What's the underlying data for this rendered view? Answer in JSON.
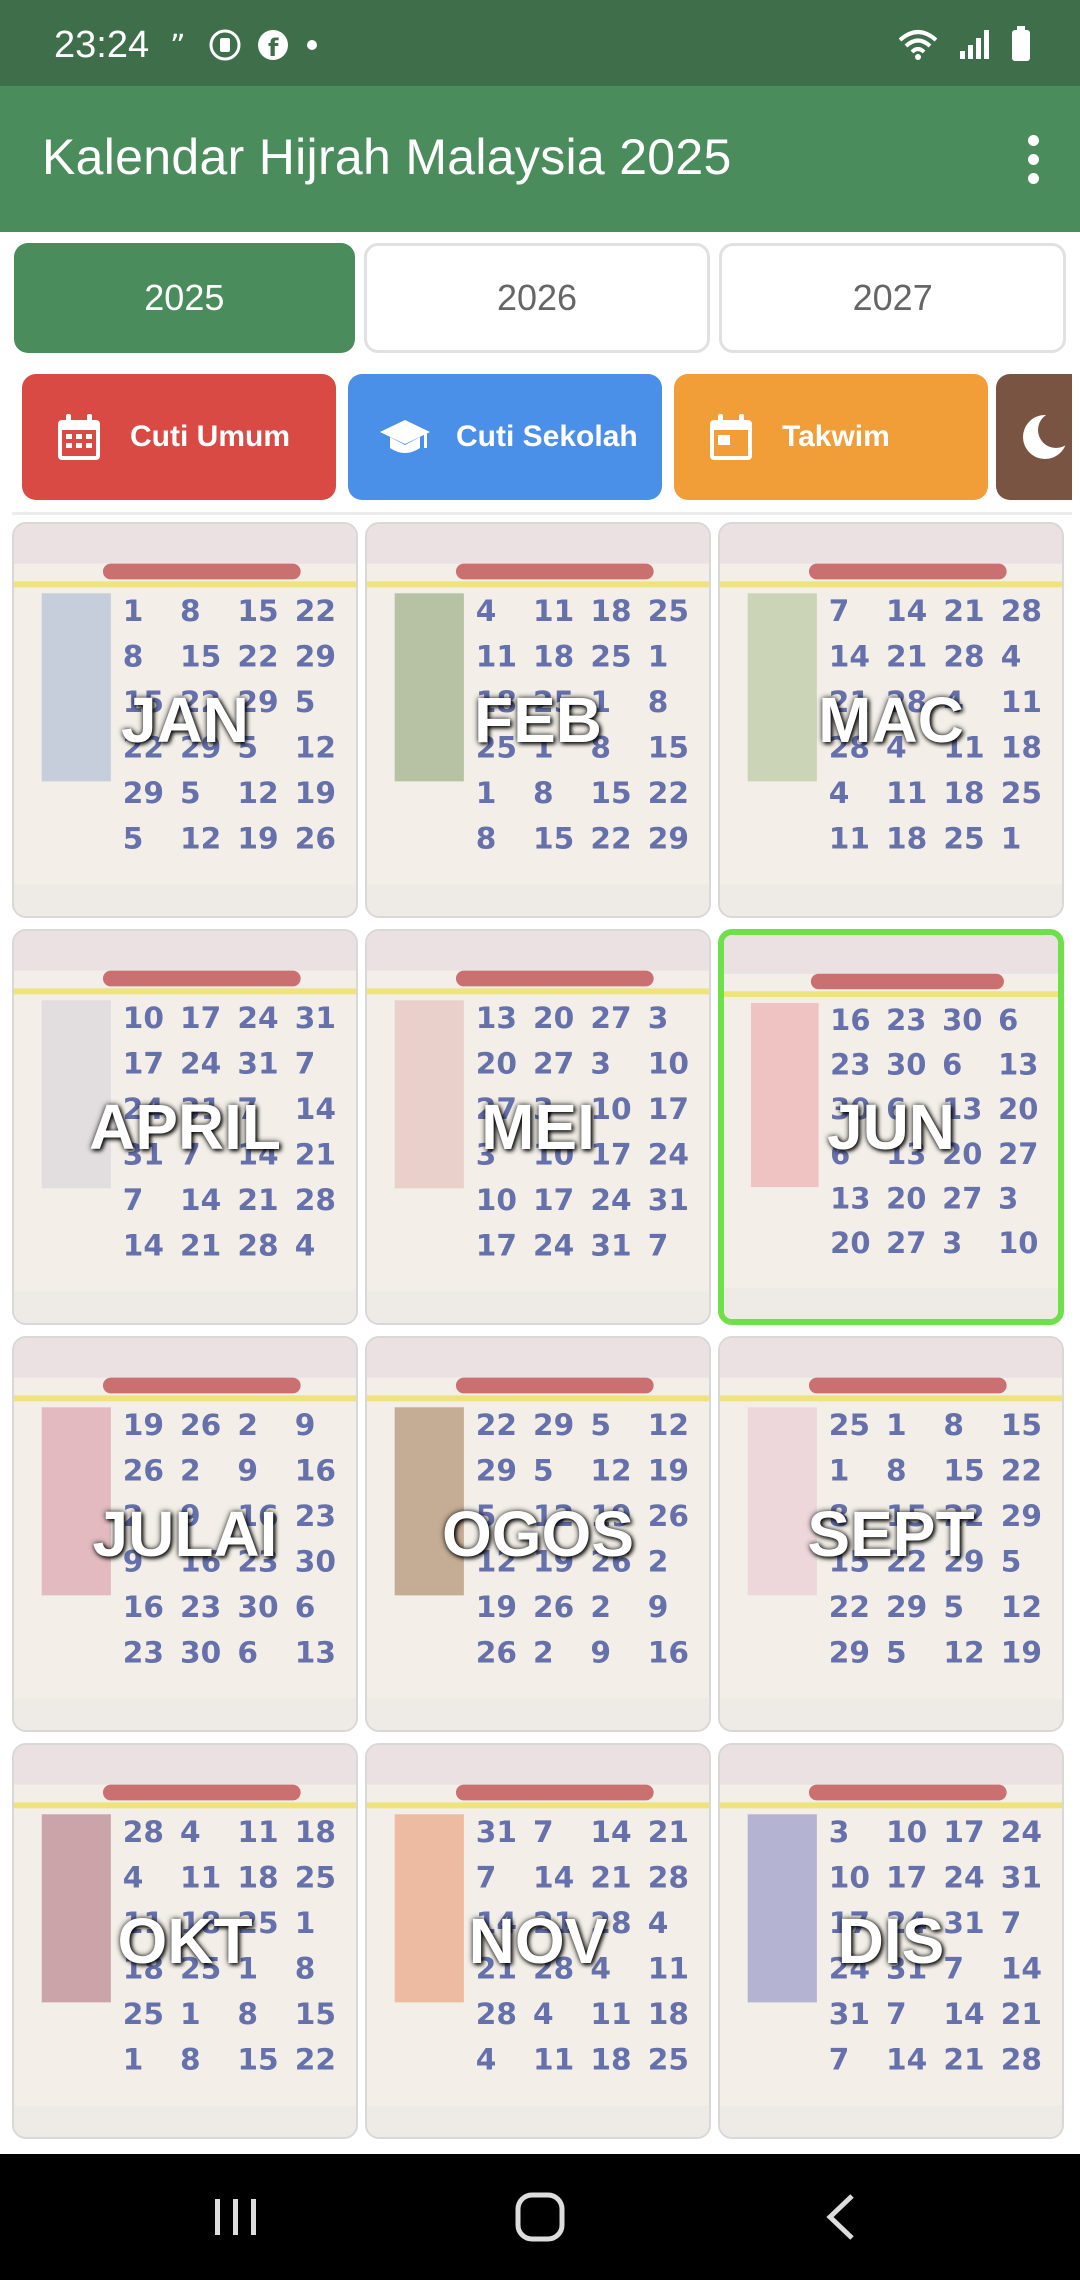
{
  "status": {
    "time": "23:24"
  },
  "app": {
    "title": "Kalendar Hijrah Malaysia 2025"
  },
  "years": [
    {
      "label": "2025",
      "active": true
    },
    {
      "label": "2026",
      "active": false
    },
    {
      "label": "2027",
      "active": false
    }
  ],
  "categories": [
    {
      "label": "Cuti Umum",
      "icon": "calendar-icon",
      "color": "#d84a43"
    },
    {
      "label": "Cuti Sekolah",
      "icon": "graduation-cap-icon",
      "color": "#4a90e8"
    },
    {
      "label": "Takwim",
      "icon": "calendar-event-icon",
      "color": "#f19d38"
    },
    {
      "label": "",
      "icon": "moon-icon",
      "color": "#7a5443"
    }
  ],
  "months": [
    {
      "label": "JAN",
      "selected": false
    },
    {
      "label": "FEB",
      "selected": false
    },
    {
      "label": "MAC",
      "selected": false
    },
    {
      "label": "APRIL",
      "selected": false
    },
    {
      "label": "MEI",
      "selected": false
    },
    {
      "label": "JUN",
      "selected": true
    },
    {
      "label": "JULAI",
      "selected": false
    },
    {
      "label": "OGOS",
      "selected": false
    },
    {
      "label": "SEPT",
      "selected": false
    },
    {
      "label": "OKT",
      "selected": false
    },
    {
      "label": "NOV",
      "selected": false
    },
    {
      "label": "DIS",
      "selected": false
    }
  ],
  "colors": {
    "status_bar": "#3e6e4a",
    "app_bar": "#4a8c5c",
    "selected_border": "#6ee04a"
  }
}
